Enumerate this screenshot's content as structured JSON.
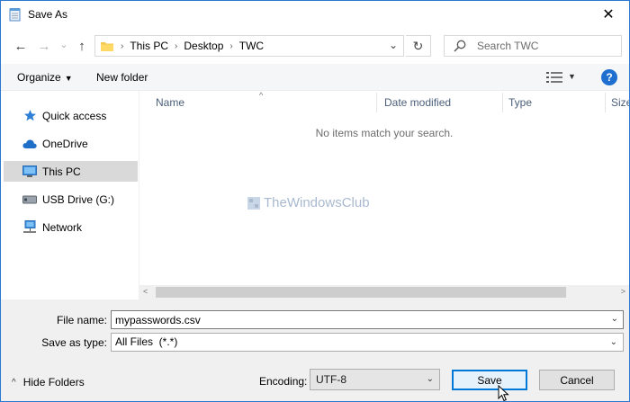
{
  "window": {
    "title": "Save As",
    "close_glyph": "✕"
  },
  "icons": {
    "title": "notepad-icon",
    "back": "arrow-left-icon",
    "forward": "arrow-right-icon",
    "recent": "chevron-down-icon",
    "up": "arrow-up-icon",
    "refresh": "refresh-icon",
    "search": "search-icon",
    "view": "view-details-icon",
    "help": "help-icon"
  },
  "nav": {
    "back_glyph": "←",
    "forward_glyph": "→",
    "recent_glyph": "⌄",
    "up_glyph": "↑",
    "breadcrumb": [
      "This PC",
      "Desktop",
      "TWC"
    ],
    "crumb_sep": "›",
    "addr_drop_glyph": "⌄",
    "refresh_glyph": "↻",
    "search_placeholder": "Search TWC"
  },
  "toolbar": {
    "organize": "Organize",
    "caret": "▼",
    "new_folder": "New folder",
    "help_glyph": "?"
  },
  "sidebar": {
    "items": [
      {
        "label": "Quick access",
        "icon": "star-icon"
      },
      {
        "label": "OneDrive",
        "icon": "cloud-icon"
      },
      {
        "label": "This PC",
        "icon": "monitor-icon",
        "selected": true
      },
      {
        "label": "USB Drive (G:)",
        "icon": "usb-drive-icon"
      },
      {
        "label": "Network",
        "icon": "network-icon"
      }
    ]
  },
  "filepane": {
    "columns": [
      "Name",
      "Date modified",
      "Type",
      "Size"
    ],
    "sort_glyph": "^",
    "empty_message": "No items match your search.",
    "watermark": "TheWindowsClub",
    "scroll_left": "<",
    "scroll_right": ">"
  },
  "form": {
    "filename_label": "File name:",
    "filename_value": "mypasswords.csv",
    "savetype_label": "Save as type:",
    "savetype_value": "All Files  (*.*)",
    "combo_caret": "⌄"
  },
  "footer": {
    "hide_folders": "Hide Folders",
    "hide_caret": "^",
    "encoding_label": "Encoding:",
    "encoding_value": "UTF-8",
    "save": "Save",
    "cancel": "Cancel"
  },
  "colors": {
    "accent": "#0078d7",
    "selection": "#d9d9d9",
    "header_text": "#4c607a"
  }
}
